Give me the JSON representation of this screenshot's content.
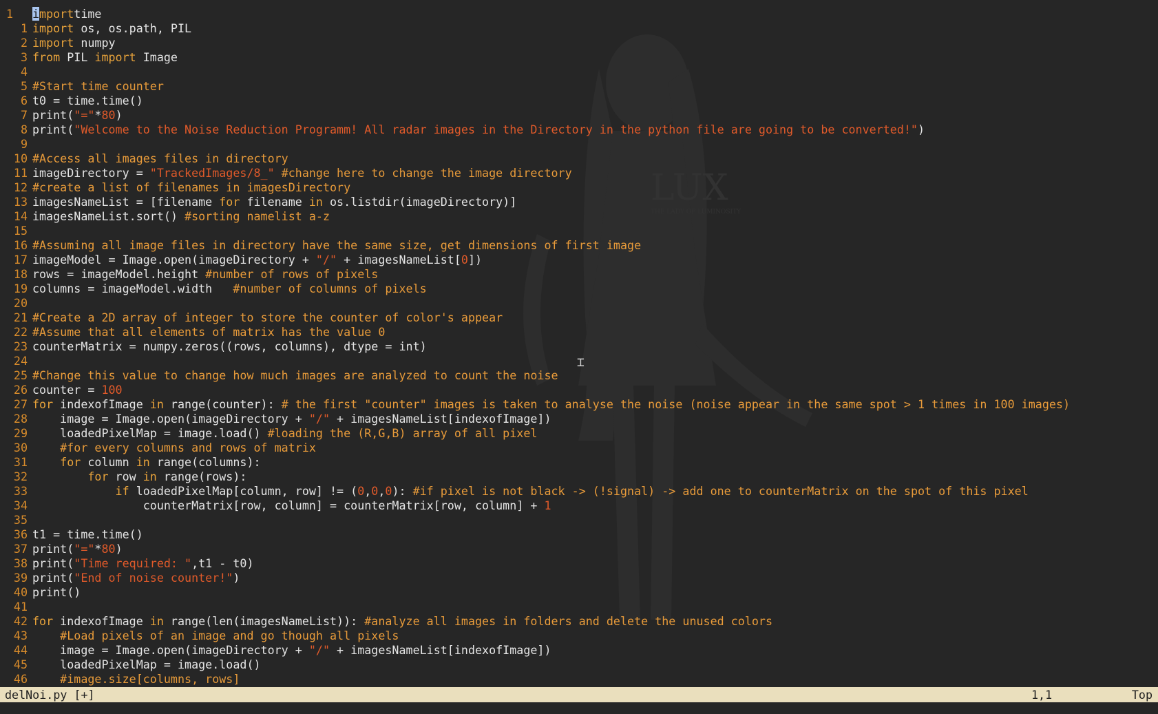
{
  "editor": {
    "file_name": "delNoi.py [+]",
    "cursor_position": "1,1",
    "scroll_position": "Top",
    "background_art_text": "LUX",
    "background_art_subtext": "THE LADY OF LUMINOSITY",
    "lines": [
      {
        "n": "1",
        "t": [
          [
            "cursor",
            "i"
          ],
          [
            "kw",
            "mport"
          ],
          [
            "",
            "time"
          ]
        ]
      },
      {
        "n": "1",
        "t": [
          [
            "kw",
            "import"
          ],
          [
            "",
            " os, os.path, PIL"
          ]
        ]
      },
      {
        "n": "2",
        "t": [
          [
            "kw",
            "import"
          ],
          [
            "",
            " numpy"
          ]
        ]
      },
      {
        "n": "3",
        "t": [
          [
            "kw",
            "from"
          ],
          [
            "",
            " PIL "
          ],
          [
            "kw",
            "import"
          ],
          [
            "",
            " Image"
          ]
        ]
      },
      {
        "n": "4",
        "t": []
      },
      {
        "n": "5",
        "t": [
          [
            "cm",
            "#Start time counter"
          ]
        ]
      },
      {
        "n": "6",
        "t": [
          [
            "",
            "t0 = time.time()"
          ]
        ]
      },
      {
        "n": "7",
        "t": [
          [
            "",
            "print("
          ],
          [
            "str",
            "\"=\""
          ],
          [
            "",
            "*"
          ],
          [
            "num",
            "80"
          ],
          [
            "",
            ")"
          ]
        ]
      },
      {
        "n": "8",
        "t": [
          [
            "",
            "print("
          ],
          [
            "str",
            "\"Welcome to the Noise Reduction Programm! All radar images in the Directory in the python file are going to be converted!\""
          ],
          [
            "",
            ")"
          ]
        ]
      },
      {
        "n": "9",
        "t": []
      },
      {
        "n": "10",
        "t": [
          [
            "cm",
            "#Access all images files in directory"
          ]
        ]
      },
      {
        "n": "11",
        "t": [
          [
            "",
            "imageDirectory = "
          ],
          [
            "str",
            "\"TrackedImages/8_\""
          ],
          [
            "",
            " "
          ],
          [
            "cm",
            "#change here to change the image directory"
          ]
        ]
      },
      {
        "n": "12",
        "t": [
          [
            "cm",
            "#create a list of filenames in imagesDirectory"
          ]
        ]
      },
      {
        "n": "13",
        "t": [
          [
            "",
            "imagesNameList = [filename "
          ],
          [
            "kw",
            "for"
          ],
          [
            "",
            " filename "
          ],
          [
            "kw",
            "in"
          ],
          [
            "",
            " os.listdir(imageDirectory)]"
          ]
        ]
      },
      {
        "n": "14",
        "t": [
          [
            "",
            "imagesNameList.sort() "
          ],
          [
            "cm",
            "#sorting namelist a-z"
          ]
        ]
      },
      {
        "n": "15",
        "t": []
      },
      {
        "n": "16",
        "t": [
          [
            "cm",
            "#Assuming all image files in directory have the same size, get dimensions of first image"
          ]
        ]
      },
      {
        "n": "17",
        "t": [
          [
            "",
            "imageModel = Image.open(imageDirectory + "
          ],
          [
            "str",
            "\"/\""
          ],
          [
            "",
            " + imagesNameList["
          ],
          [
            "num",
            "0"
          ],
          [
            "",
            "])"
          ]
        ]
      },
      {
        "n": "18",
        "t": [
          [
            "",
            "rows = imageModel.height "
          ],
          [
            "cm",
            "#number of rows of pixels"
          ]
        ]
      },
      {
        "n": "19",
        "t": [
          [
            "",
            "columns = imageModel.width   "
          ],
          [
            "cm",
            "#number of columns of pixels"
          ]
        ]
      },
      {
        "n": "20",
        "t": []
      },
      {
        "n": "21",
        "t": [
          [
            "cm",
            "#Create a 2D array of integer to store the counter of color's appear"
          ]
        ]
      },
      {
        "n": "22",
        "t": [
          [
            "cm",
            "#Assume that all elements of matrix has the value 0"
          ]
        ]
      },
      {
        "n": "23",
        "t": [
          [
            "",
            "counterMatrix = numpy.zeros((rows, columns), dtype = int)"
          ]
        ]
      },
      {
        "n": "24",
        "t": []
      },
      {
        "n": "25",
        "t": [
          [
            "cm",
            "#Change this value to change how much images are analyzed to count the noise"
          ]
        ]
      },
      {
        "n": "26",
        "t": [
          [
            "",
            "counter = "
          ],
          [
            "num",
            "100"
          ]
        ]
      },
      {
        "n": "27",
        "t": [
          [
            "kw",
            "for"
          ],
          [
            "",
            " indexofImage "
          ],
          [
            "kw",
            "in"
          ],
          [
            "",
            " range(counter): "
          ],
          [
            "cm",
            "# the first \"counter\" images is taken to analyse the noise (noise appear in the same spot > 1 times in 100 images)"
          ]
        ]
      },
      {
        "n": "28",
        "t": [
          [
            "",
            "    image = Image.open(imageDirectory + "
          ],
          [
            "str",
            "\"/\""
          ],
          [
            "",
            " + imagesNameList[indexofImage])"
          ]
        ]
      },
      {
        "n": "29",
        "t": [
          [
            "",
            "    loadedPixelMap = image.load() "
          ],
          [
            "cm",
            "#loading the (R,G,B) array of all pixel"
          ]
        ]
      },
      {
        "n": "30",
        "t": [
          [
            "cm",
            "    #for every columns and rows of matrix"
          ]
        ]
      },
      {
        "n": "31",
        "t": [
          [
            "kw",
            "    for"
          ],
          [
            "",
            " column "
          ],
          [
            "kw",
            "in"
          ],
          [
            "",
            " range(columns):"
          ]
        ]
      },
      {
        "n": "32",
        "t": [
          [
            "kw",
            "        for"
          ],
          [
            "",
            " row "
          ],
          [
            "kw",
            "in"
          ],
          [
            "",
            " range(rows):"
          ]
        ]
      },
      {
        "n": "33",
        "t": [
          [
            "kw",
            "            if"
          ],
          [
            "",
            " loadedPixelMap[column, row] != ("
          ],
          [
            "num",
            "0"
          ],
          [
            "",
            ","
          ],
          [
            "num",
            "0"
          ],
          [
            "",
            ","
          ],
          [
            "num",
            "0"
          ],
          [
            "",
            "): "
          ],
          [
            "cm",
            "#if pixel is not black -> (!signal) -> add one to counterMatrix on the spot of this pixel"
          ]
        ]
      },
      {
        "n": "34",
        "t": [
          [
            "",
            "                counterMatrix[row, column] = counterMatrix[row, column] + "
          ],
          [
            "num",
            "1"
          ]
        ]
      },
      {
        "n": "35",
        "t": []
      },
      {
        "n": "36",
        "t": [
          [
            "",
            "t1 = time.time()"
          ]
        ]
      },
      {
        "n": "37",
        "t": [
          [
            "",
            "print("
          ],
          [
            "str",
            "\"=\""
          ],
          [
            "",
            "*"
          ],
          [
            "num",
            "80"
          ],
          [
            "",
            ")"
          ]
        ]
      },
      {
        "n": "38",
        "t": [
          [
            "",
            "print("
          ],
          [
            "str",
            "\"Time required: \""
          ],
          [
            "",
            ",t1 - t0)"
          ]
        ]
      },
      {
        "n": "39",
        "t": [
          [
            "",
            "print("
          ],
          [
            "str",
            "\"End of noise counter!\""
          ],
          [
            "",
            ")"
          ]
        ]
      },
      {
        "n": "40",
        "t": [
          [
            "",
            "print()"
          ]
        ]
      },
      {
        "n": "41",
        "t": []
      },
      {
        "n": "42",
        "t": [
          [
            "kw",
            "for"
          ],
          [
            "",
            " indexofImage "
          ],
          [
            "kw",
            "in"
          ],
          [
            "",
            " range(len(imagesNameList)): "
          ],
          [
            "cm",
            "#analyze all images in folders and delete the unused colors"
          ]
        ]
      },
      {
        "n": "43",
        "t": [
          [
            "cm",
            "    #Load pixels of an image and go though all pixels"
          ]
        ]
      },
      {
        "n": "44",
        "t": [
          [
            "",
            "    image = Image.open(imageDirectory + "
          ],
          [
            "str",
            "\"/\""
          ],
          [
            "",
            " + imagesNameList[indexofImage])"
          ]
        ]
      },
      {
        "n": "45",
        "t": [
          [
            "",
            "    loadedPixelMap = image.load()"
          ]
        ]
      },
      {
        "n": "46",
        "t": [
          [
            "cm",
            "    #image.size[columns, rows]"
          ]
        ]
      }
    ]
  },
  "colors": {
    "background": "#262626",
    "keyword": "#e8a33b",
    "string": "#e05a2a",
    "comment": "#e89b3a",
    "line_number": "#d98c2b",
    "statusline_bg": "#eadfbd"
  }
}
